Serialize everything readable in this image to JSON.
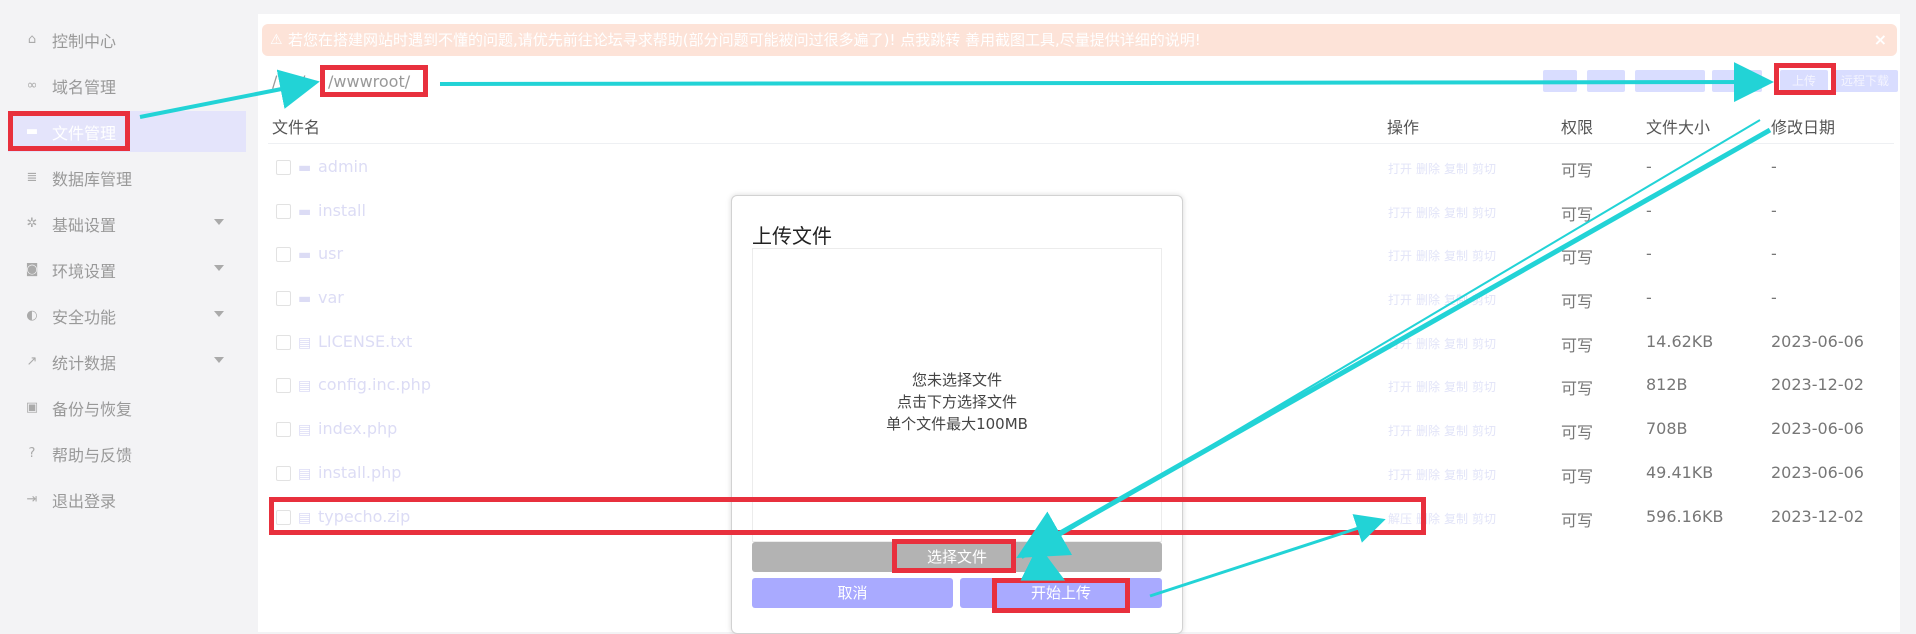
{
  "sidebar": {
    "items": [
      {
        "label": "控制中心",
        "icon": "home-icon"
      },
      {
        "label": "域名管理",
        "icon": "link-icon"
      },
      {
        "label": "文件管理",
        "icon": "folder-icon",
        "active": true
      },
      {
        "label": "数据库管理",
        "icon": "database-icon"
      },
      {
        "label": "基础设置",
        "icon": "gear-icon",
        "expandable": true
      },
      {
        "label": "环境设置",
        "icon": "drive-icon",
        "expandable": true
      },
      {
        "label": "安全功能",
        "icon": "shield-icon",
        "expandable": true
      },
      {
        "label": "统计数据",
        "icon": "chart-icon",
        "expandable": true
      },
      {
        "label": "备份与恢复",
        "icon": "archive-icon"
      },
      {
        "label": "帮助与反馈",
        "icon": "help-icon"
      },
      {
        "label": "退出登录",
        "icon": "logout-icon"
      }
    ]
  },
  "alert": {
    "text": "若您在搭建网站时遇到不懂的问题,请优先前往论坛寻求帮助(部分问题可能被问过很多遍了)! 点我跳转 善用截图工具,尽量提供详细的说明!",
    "close": "×"
  },
  "path": {
    "root": "/",
    "sep": "/",
    "current": "/wwwroot/"
  },
  "toolbar": {
    "upload": "上传",
    "remote_download": "远程下载"
  },
  "table": {
    "headers": {
      "name": "文件名",
      "ops": "操作",
      "perm": "权限",
      "size": "文件大小",
      "date": "修改日期"
    },
    "rows": [
      {
        "name": "admin",
        "type": "folder",
        "ops": [
          "打开",
          "删除",
          "复制",
          "剪切"
        ],
        "perm": "可写",
        "size": "-",
        "date": "-"
      },
      {
        "name": "install",
        "type": "folder",
        "ops": [
          "打开",
          "删除",
          "复制",
          "剪切"
        ],
        "perm": "可写",
        "size": "-",
        "date": "-"
      },
      {
        "name": "usr",
        "type": "folder",
        "ops": [
          "打开",
          "删除",
          "复制",
          "剪切"
        ],
        "perm": "可写",
        "size": "-",
        "date": "-"
      },
      {
        "name": "var",
        "type": "folder",
        "ops": [
          "打开",
          "删除",
          "复制",
          "剪切"
        ],
        "perm": "可写",
        "size": "-",
        "date": "-"
      },
      {
        "name": "LICENSE.txt",
        "type": "file",
        "ops": [
          "打开",
          "删除",
          "复制",
          "剪切"
        ],
        "perm": "可写",
        "size": "14.62KB",
        "date": "2023-06-06"
      },
      {
        "name": "config.inc.php",
        "type": "file",
        "ops": [
          "打开",
          "删除",
          "复制",
          "剪切"
        ],
        "perm": "可写",
        "size": "812B",
        "date": "2023-12-02"
      },
      {
        "name": "index.php",
        "type": "file",
        "ops": [
          "打开",
          "删除",
          "复制",
          "剪切"
        ],
        "perm": "可写",
        "size": "708B",
        "date": "2023-06-06"
      },
      {
        "name": "install.php",
        "type": "file",
        "ops": [
          "打开",
          "删除",
          "复制",
          "剪切"
        ],
        "perm": "可写",
        "size": "49.41KB",
        "date": "2023-06-06"
      },
      {
        "name": "typecho.zip",
        "type": "file",
        "ops": [
          "解压",
          "删除",
          "复制",
          "剪切"
        ],
        "perm": "可写",
        "size": "596.16KB",
        "date": "2023-12-02"
      }
    ]
  },
  "modal": {
    "title": "上传文件",
    "line1": "您未选择文件",
    "line2": "点击下方选择文件",
    "line3": "单个文件最大100MB",
    "choose": "选择文件",
    "cancel": "取消",
    "start": "开始上传"
  },
  "colors": {
    "highlight": "#e8303d",
    "arrow": "#22d3d6",
    "accent": "#a9aaff"
  }
}
